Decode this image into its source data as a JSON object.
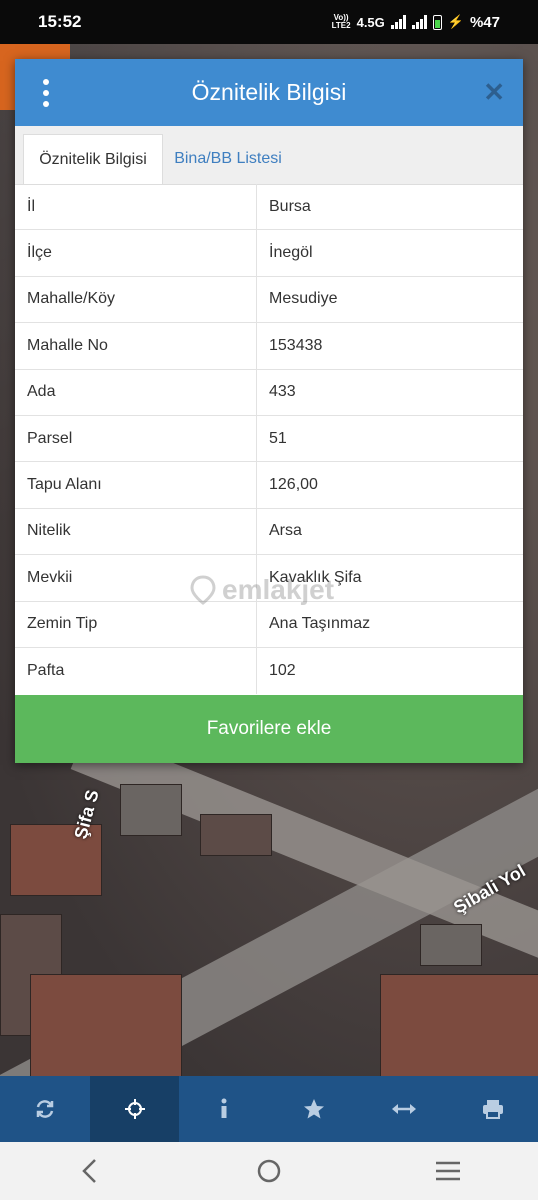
{
  "status_bar": {
    "time": "15:52",
    "volte_top": "Vo))",
    "volte_bottom": "LTE2",
    "network": "4.5G",
    "battery_percent": "%47",
    "battery_level": 0.47
  },
  "map": {
    "road_label_1": "Şifa S",
    "road_label_2": "Şibali Yol"
  },
  "dialog": {
    "title": "Öznitelik Bilgisi",
    "menu_icon": "kebab-menu-icon",
    "close_icon": "close-icon",
    "tabs": [
      {
        "label": "Öznitelik Bilgisi",
        "active": true
      },
      {
        "label": "Bina/BB Listesi",
        "active": false
      }
    ],
    "rows": [
      {
        "key": "İl",
        "value": "Bursa"
      },
      {
        "key": "İlçe",
        "value": "İnegöl"
      },
      {
        "key": "Mahalle/Köy",
        "value": "Mesudiye"
      },
      {
        "key": "Mahalle No",
        "value": "153438"
      },
      {
        "key": "Ada",
        "value": "433"
      },
      {
        "key": "Parsel",
        "value": "51"
      },
      {
        "key": "Tapu Alanı",
        "value": "126,00"
      },
      {
        "key": "Nitelik",
        "value": "Arsa"
      },
      {
        "key": "Mevkii",
        "value": "Kavaklık Şifa"
      },
      {
        "key": "Zemin Tip",
        "value": "Ana Taşınmaz"
      },
      {
        "key": "Pafta",
        "value": "102"
      }
    ],
    "favorite_button": "Favorilere ekle",
    "watermark": "emlakjet"
  },
  "toolbar": {
    "tools": [
      "refresh-icon",
      "locate-icon",
      "info-icon",
      "star-icon",
      "measure-icon",
      "print-icon"
    ],
    "active_index": 1
  },
  "colors": {
    "header_blue": "#3f8bd0",
    "tab_link_blue": "#3f7fc0",
    "button_green": "#5cb85c",
    "toolbar_blue": "#1f5387"
  }
}
